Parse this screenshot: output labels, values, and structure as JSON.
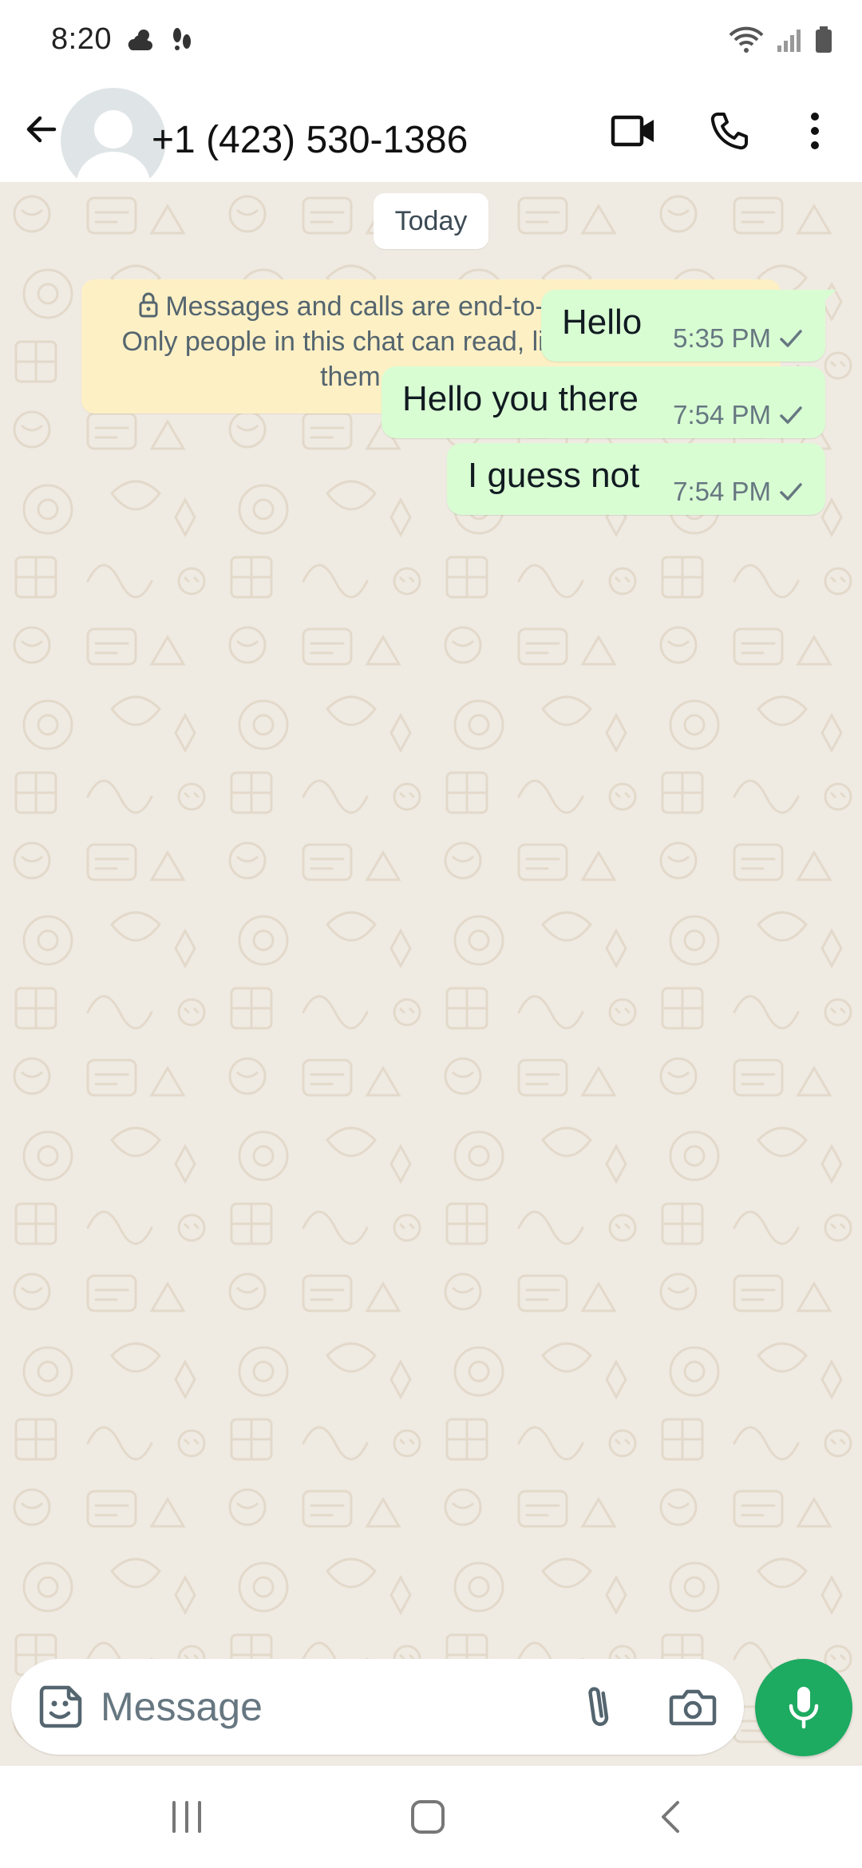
{
  "status_bar": {
    "time": "8:20",
    "left_icons": [
      "weather-icon",
      "activity-icon"
    ],
    "right_icons": [
      "wifi-icon",
      "signal-icon",
      "battery-icon"
    ]
  },
  "header": {
    "contact": "+1 (423) 530-1386",
    "actions": [
      "video-call-icon",
      "voice-call-icon",
      "more-options-icon"
    ]
  },
  "chat": {
    "date_chip": "Today",
    "encryption_notice": {
      "line1": "Messages and calls are end-to-end encrypted.",
      "line2": "Only people in this chat can read, listen to, or share",
      "line3": "them. Learn more."
    },
    "messages": [
      {
        "text": "Hello",
        "time": "5:35 PM",
        "status": "sent"
      },
      {
        "text": "Hello you there",
        "time": "7:54 PM",
        "status": "sent"
      },
      {
        "text": "I guess not",
        "time": "7:54 PM",
        "status": "sent"
      }
    ]
  },
  "composer": {
    "placeholder": "Message",
    "icons": [
      "sticker-icon",
      "paperclip-icon",
      "camera-icon",
      "microphone-icon"
    ]
  },
  "colors": {
    "accent": "#1daa61",
    "outgoing_bubble": "#d9fdd3",
    "chat_background": "#efeae2",
    "notice_background": "#fdf0c5"
  }
}
